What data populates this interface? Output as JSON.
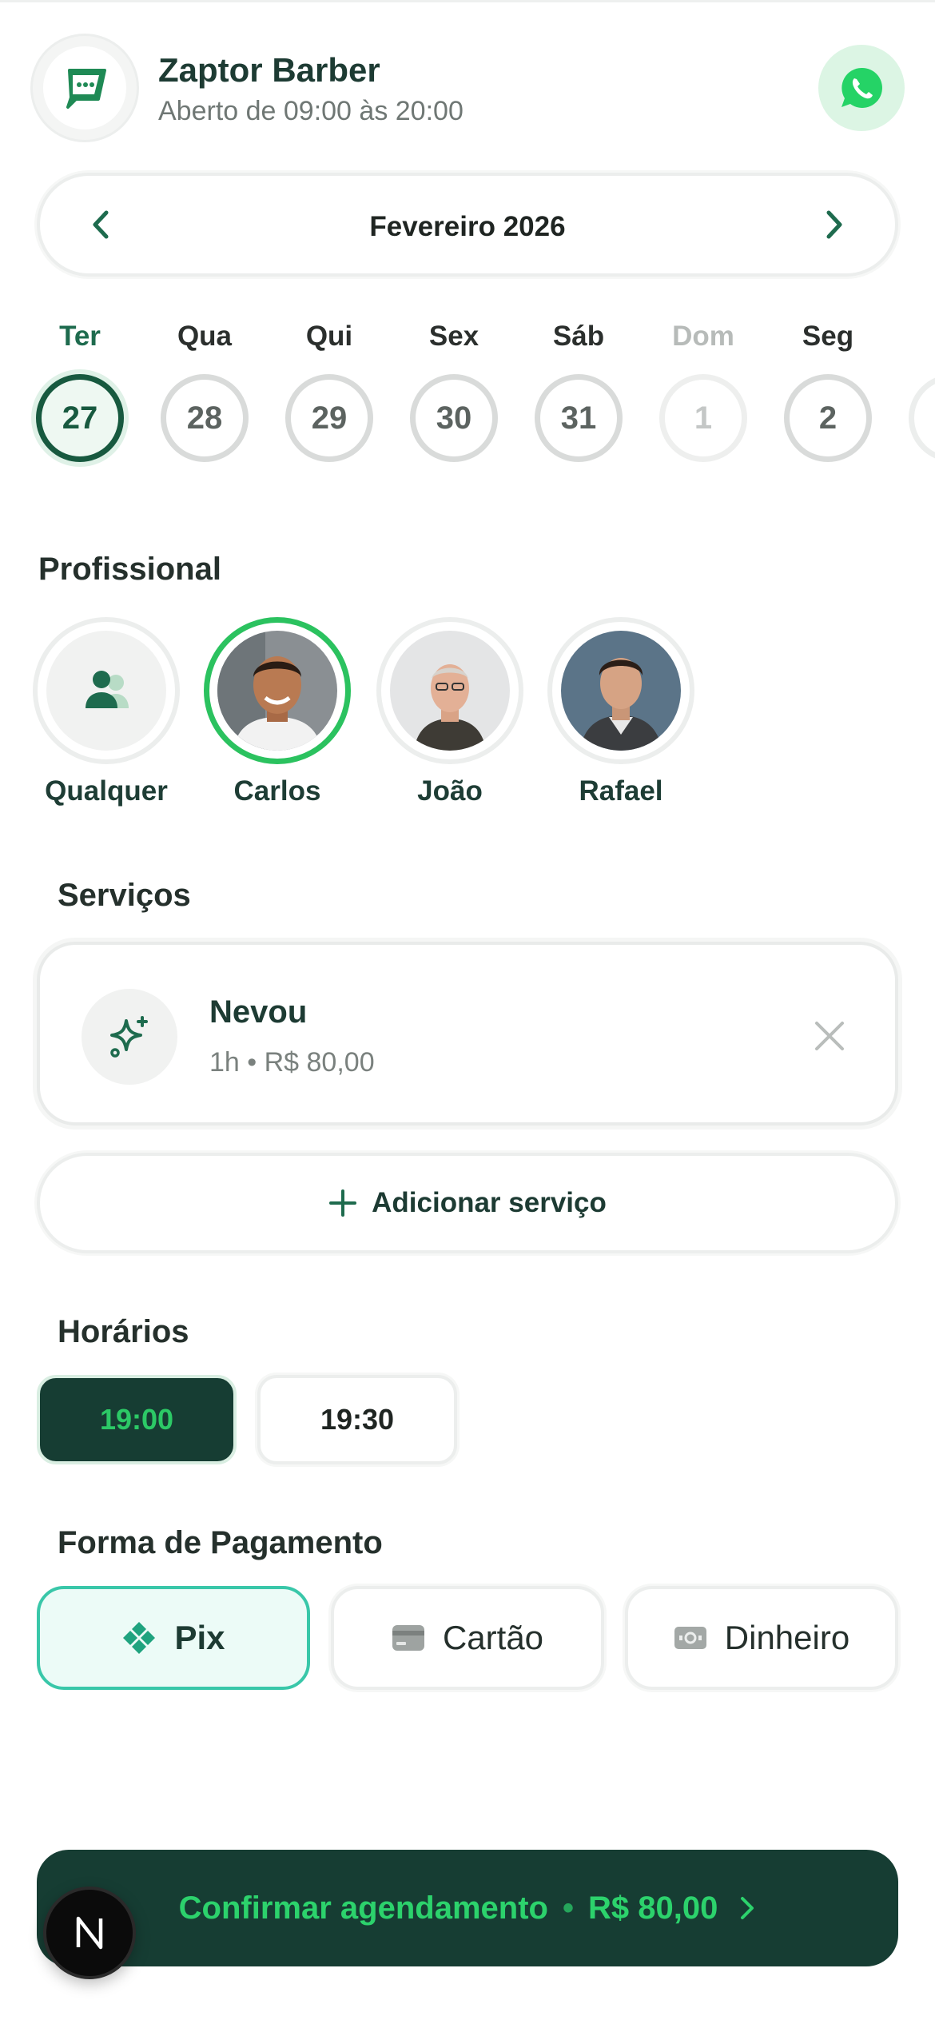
{
  "header": {
    "shop_name": "Zaptor Barber",
    "hours": "Aberto de 09:00 às 20:00",
    "logo_icon": "chat-bubble-icon",
    "whatsapp_icon": "whatsapp-icon"
  },
  "month": {
    "label": "Fevereiro 2026"
  },
  "days": [
    {
      "name": "Ter",
      "number": "27",
      "state": "selected"
    },
    {
      "name": "Qua",
      "number": "28",
      "state": "normal"
    },
    {
      "name": "Qui",
      "number": "29",
      "state": "normal"
    },
    {
      "name": "Sex",
      "number": "30",
      "state": "normal"
    },
    {
      "name": "Sáb",
      "number": "31",
      "state": "normal"
    },
    {
      "name": "Dom",
      "number": "1",
      "state": "disabled"
    },
    {
      "name": "Seg",
      "number": "2",
      "state": "normal"
    }
  ],
  "professionals": {
    "title": "Profissional",
    "items": [
      {
        "name": "Qualquer",
        "selected": false
      },
      {
        "name": "Carlos",
        "selected": true
      },
      {
        "name": "João",
        "selected": false
      },
      {
        "name": "Rafael",
        "selected": false
      }
    ]
  },
  "services": {
    "title": "Serviços",
    "items": [
      {
        "name": "Nevou",
        "meta": "1h • R$ 80,00"
      }
    ],
    "add_label": "Adicionar serviço"
  },
  "times": {
    "title": "Horários",
    "slots": [
      {
        "label": "19:00",
        "selected": true
      },
      {
        "label": "19:30",
        "selected": false
      }
    ]
  },
  "payment": {
    "title": "Forma de Pagamento",
    "options": [
      {
        "label": "Pix",
        "icon": "pix-icon",
        "selected": true
      },
      {
        "label": "Cartão",
        "icon": "card-icon",
        "selected": false
      },
      {
        "label": "Dinheiro",
        "icon": "cash-icon",
        "selected": false
      }
    ]
  },
  "confirm": {
    "label": "Confirmar agendamento",
    "price": "R$ 80,00"
  },
  "colors": {
    "brand_dark": "#163d33",
    "brand_green": "#2cc966",
    "pix_accent": "#39c7a9"
  }
}
